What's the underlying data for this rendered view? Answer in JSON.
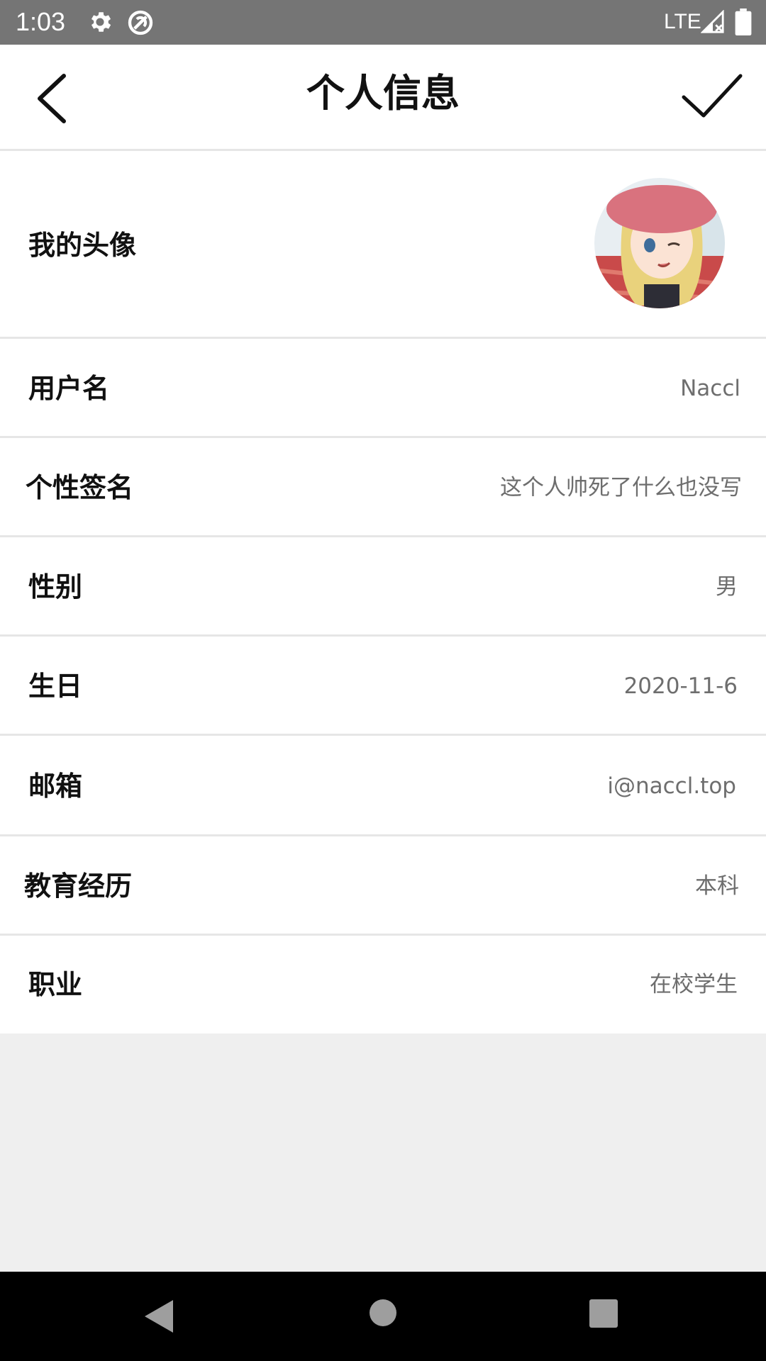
{
  "status_bar": {
    "time": "1:03",
    "network": "LTE",
    "icons": [
      "settings-icon",
      "data-saver-icon",
      "signal-icon",
      "battery-icon"
    ]
  },
  "toolbar": {
    "title": "个人信息",
    "back_icon": "back-arrow-icon",
    "confirm_icon": "check-icon"
  },
  "profile": {
    "rows": [
      {
        "label": "我的头像",
        "type": "avatar"
      },
      {
        "label": "用户名",
        "value": "Naccl"
      },
      {
        "label": "个性签名",
        "value": "这个人帅死了什么也没写"
      },
      {
        "label": "性别",
        "value": "男"
      },
      {
        "label": "生日",
        "value": "2020-11-6"
      },
      {
        "label": "邮箱",
        "value": "i@naccl.top"
      },
      {
        "label": "教育经历",
        "value": "本科"
      },
      {
        "label": "职业",
        "value": "在校学生"
      }
    ]
  },
  "nav_bar": {
    "icons": [
      "nav-back-icon",
      "nav-home-icon",
      "nav-recents-icon"
    ]
  },
  "colors": {
    "status_bar": "#757575",
    "background": "#efefef",
    "row_background": "#ffffff",
    "value_text": "#6e6e6e"
  }
}
